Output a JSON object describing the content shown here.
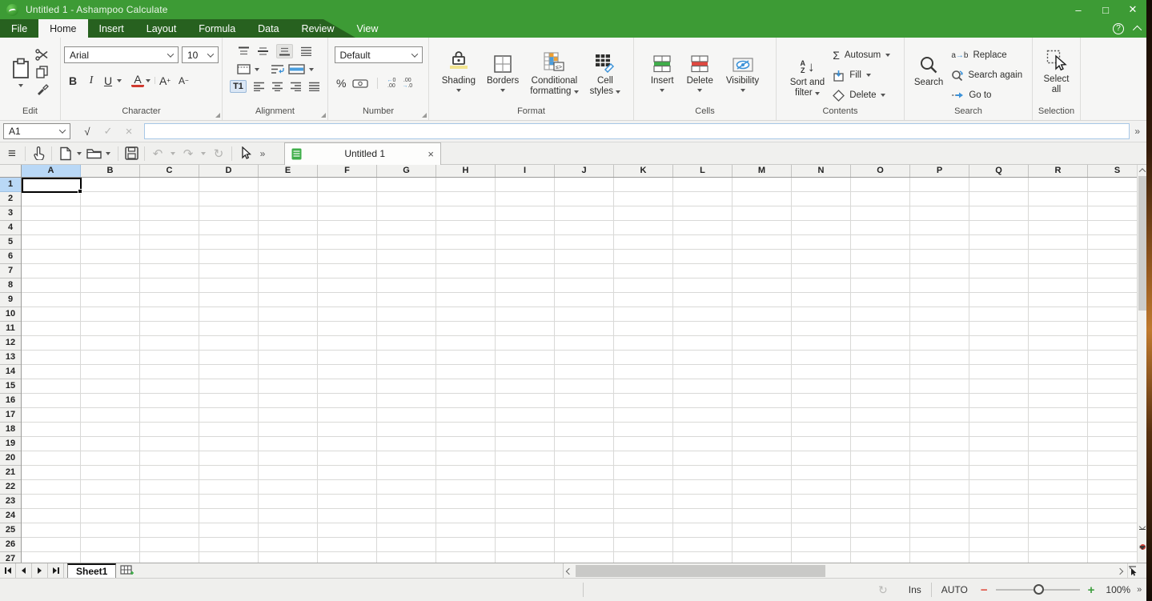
{
  "titlebar": {
    "title": "Untitled 1 - Ashampoo Calculate",
    "minimize": "–",
    "maximize": "□",
    "close": "✕"
  },
  "menubar": {
    "tabs": [
      {
        "label": "File"
      },
      {
        "label": "Home"
      },
      {
        "label": "Insert"
      },
      {
        "label": "Layout"
      },
      {
        "label": "Formula"
      },
      {
        "label": "Data"
      },
      {
        "label": "Review"
      },
      {
        "label": "View"
      }
    ],
    "help": "?"
  },
  "ribbon": {
    "edit": {
      "label": "Edit"
    },
    "character": {
      "label": "Character",
      "font": "Arial",
      "size": "10",
      "bold": "B",
      "italic": "I",
      "underline": "U",
      "font_color": "A",
      "grow": "A",
      "grow_sign": "+",
      "shrink": "A",
      "shrink_sign": "−"
    },
    "alignment": {
      "label": "Alignment",
      "vertical_text": "T1"
    },
    "number": {
      "label": "Number",
      "format": "Default",
      "percent": "%",
      "inc_top": "←0",
      "inc_bottom": ".00",
      "dec_top": ".00",
      "dec_bottom": "→.0"
    },
    "format": {
      "label": "Format",
      "shading": "Shading",
      "borders": "Borders",
      "conditional_line1": "Conditional",
      "conditional_line2": "formatting",
      "cell_styles_line1": "Cell",
      "cell_styles_line2": "styles"
    },
    "cells": {
      "label": "Cells",
      "insert": "Insert",
      "delete": "Delete",
      "visibility": "Visibility"
    },
    "contents": {
      "label": "Contents",
      "sort_line1": "Sort and",
      "sort_line2": "filter",
      "autosum": "Autosum",
      "fill": "Fill",
      "delete": "Delete",
      "sigma": "Σ",
      "sort_a": "A",
      "sort_z": "Z",
      "sort_arrow": "↓"
    },
    "search": {
      "label": "Search",
      "search": "Search",
      "replace": "Replace",
      "replace_a": "a",
      "replace_arrow": "→",
      "replace_b": "b",
      "search_again": "Search again",
      "goto": "Go to"
    },
    "selection": {
      "label": "Selection",
      "select_all_line1": "Select",
      "select_all_line2": "all"
    }
  },
  "formula_bar": {
    "cell_ref": "A1",
    "formula_icon": "√",
    "confirm_icon": "✓",
    "cancel_icon": "×",
    "value": "",
    "overflow": "»"
  },
  "toolbar": {
    "hamburger": "≡",
    "undo": "↶",
    "redo": "↷",
    "repeat": "↻",
    "overflow": "»"
  },
  "document_tab": {
    "label": "Untitled 1",
    "close": "×"
  },
  "grid": {
    "columns": [
      "A",
      "B",
      "C",
      "D",
      "E",
      "F",
      "G",
      "H",
      "I",
      "J",
      "K",
      "L",
      "M",
      "N",
      "O",
      "P",
      "Q",
      "R",
      "S"
    ],
    "row_count": 27,
    "selected_cell": "A1",
    "selected_column": "A",
    "selected_row": "1"
  },
  "sheet_bar": {
    "sheet_tabs": [
      {
        "label": "Sheet1"
      }
    ]
  },
  "status_bar": {
    "refresh": "↻",
    "insert_mode": "Ins",
    "recalc_mode": "AUTO",
    "zoom_out": "−",
    "zoom_in": "+",
    "zoom_level": "100%",
    "overflow": "»"
  }
}
